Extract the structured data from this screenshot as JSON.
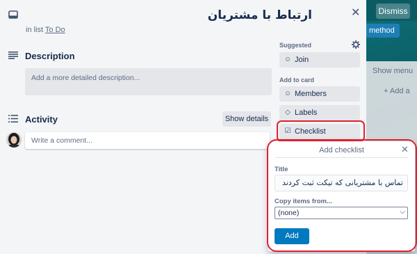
{
  "board": {
    "dismiss_label": "Dismiss",
    "method_label": "method",
    "show_menu_label": "Show menu",
    "add_another_label": "+ Add a"
  },
  "card": {
    "title": "ارتباط با مشتریان",
    "in_list_prefix": "in list",
    "list_name": "To Do",
    "close_icon": "close-icon"
  },
  "description": {
    "title": "Description",
    "placeholder": "Add a more detailed description..."
  },
  "activity": {
    "title": "Activity",
    "show_details_label": "Show details",
    "comment_placeholder": "Write a comment..."
  },
  "sidebar": {
    "suggested_label": "Suggested",
    "join_label": "Join",
    "add_to_card_label": "Add to card",
    "members_label": "Members",
    "labels_label": "Labels",
    "checklist_label": "Checklist"
  },
  "popover": {
    "title": "Add checklist",
    "title_field_label": "Title",
    "title_value": "تماس با مشتریانی که تیکت ثبت کردند",
    "copy_label": "Copy items from...",
    "copy_selected": "(none)",
    "add_label": "Add"
  },
  "colors": {
    "accent": "#0079bf",
    "highlight": "#e0202f"
  }
}
